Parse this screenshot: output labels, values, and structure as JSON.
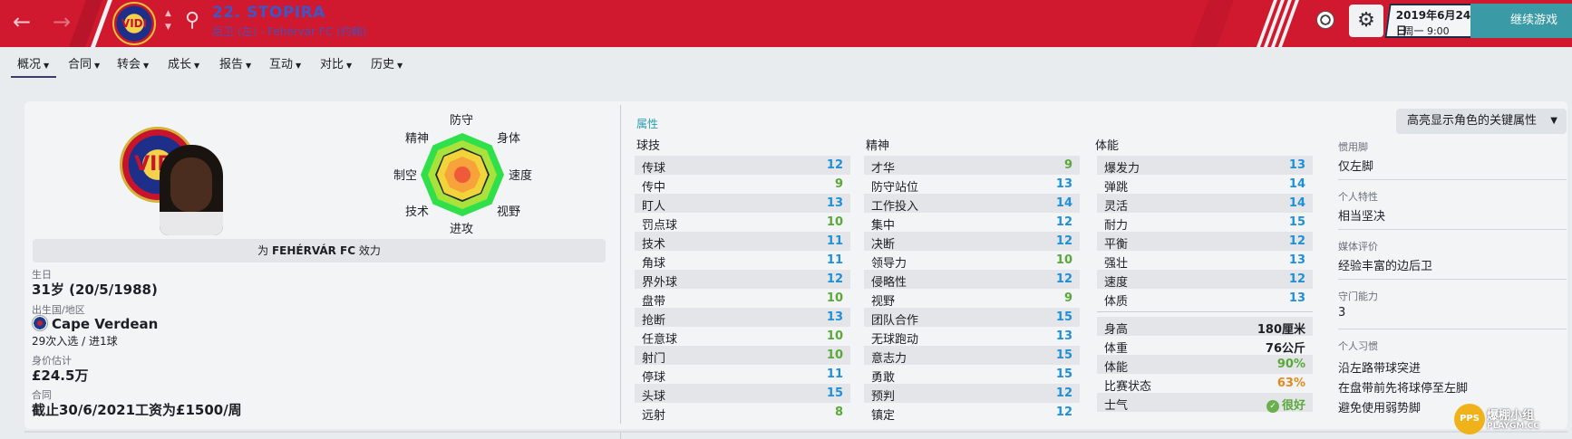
{
  "header": {
    "back_icon": "arrow-left-icon",
    "forward_icon": "arrow-right-icon",
    "club_badge_text": "VIDI",
    "player_title": "22. STOPIRA",
    "player_subtitle": "后卫 (左) - Fehérvár FC (约翰)",
    "continue_label": "继续游戏",
    "date_main": "2019年6月24日",
    "date_sub": "周一 9:00",
    "colors": {
      "primary": "#d0182e",
      "accent": "#3a9aa5"
    }
  },
  "tabs": [
    {
      "label": "概况"
    },
    {
      "label": "合同"
    },
    {
      "label": "转会"
    },
    {
      "label": "成长"
    },
    {
      "label": "报告"
    },
    {
      "label": "互动"
    },
    {
      "label": "对比"
    },
    {
      "label": "历史"
    }
  ],
  "radar": {
    "labels": {
      "defending": "防守",
      "physical": "身体",
      "speed": "速度",
      "vision": "视野",
      "attacking": "进攻",
      "technique": "技术",
      "aerial": "制空",
      "mental": "精神"
    }
  },
  "profile": {
    "club_badge_text": "VIDI",
    "plays_for_prefix": "为 ",
    "plays_for_club": "FEHÉRVÁR FC",
    "plays_for_suffix": " 效力",
    "dob_label": "生日",
    "dob_value": "31岁 (20/5/1988)",
    "nation_label": "出生国/地区",
    "nation_value": "Cape Verdean",
    "caps": "29次入选 / 进1球",
    "value_label": "身价估计",
    "value_value": "£24.5万",
    "contract_label": "合同",
    "contract_value": "截止30/6/2021工资为£1500/周"
  },
  "attributes": {
    "section_title": "属性",
    "highlight_button": "高亮显示角色的关键属性",
    "technical_title": "球技",
    "mental_title": "精神",
    "physical_title": "体能",
    "technical": [
      {
        "name": "传球",
        "value": "12"
      },
      {
        "name": "传中",
        "value": "9"
      },
      {
        "name": "盯人",
        "value": "13"
      },
      {
        "name": "罚点球",
        "value": "10"
      },
      {
        "name": "技术",
        "value": "11"
      },
      {
        "name": "角球",
        "value": "11"
      },
      {
        "name": "界外球",
        "value": "12"
      },
      {
        "name": "盘带",
        "value": "10"
      },
      {
        "name": "抢断",
        "value": "13"
      },
      {
        "name": "任意球",
        "value": "10"
      },
      {
        "name": "射门",
        "value": "10"
      },
      {
        "name": "停球",
        "value": "11"
      },
      {
        "name": "头球",
        "value": "15"
      },
      {
        "name": "远射",
        "value": "8"
      }
    ],
    "mental": [
      {
        "name": "才华",
        "value": "9"
      },
      {
        "name": "防守站位",
        "value": "13"
      },
      {
        "name": "工作投入",
        "value": "14"
      },
      {
        "name": "集中",
        "value": "12"
      },
      {
        "name": "决断",
        "value": "12"
      },
      {
        "name": "领导力",
        "value": "10"
      },
      {
        "name": "侵略性",
        "value": "12"
      },
      {
        "name": "视野",
        "value": "9"
      },
      {
        "name": "团队合作",
        "value": "15"
      },
      {
        "name": "无球跑动",
        "value": "13"
      },
      {
        "name": "意志力",
        "value": "15"
      },
      {
        "name": "勇敢",
        "value": "15"
      },
      {
        "name": "预判",
        "value": "12"
      },
      {
        "name": "镇定",
        "value": "12"
      }
    ],
    "physical": [
      {
        "name": "爆发力",
        "value": "13"
      },
      {
        "name": "弹跳",
        "value": "14"
      },
      {
        "name": "灵活",
        "value": "14"
      },
      {
        "name": "耐力",
        "value": "15"
      },
      {
        "name": "平衡",
        "value": "12"
      },
      {
        "name": "强壮",
        "value": "13"
      },
      {
        "name": "速度",
        "value": "12"
      },
      {
        "name": "体质",
        "value": "13"
      }
    ],
    "extras": [
      {
        "name": "身高",
        "value": "180厘米"
      },
      {
        "name": "体重",
        "value": "76公斤"
      },
      {
        "name": "体能",
        "value": "90%"
      },
      {
        "name": "比赛状态",
        "value": "63%"
      },
      {
        "name": "士气",
        "value": "很好"
      }
    ],
    "colors": {
      "low": "#5aa83a",
      "high": "#1f8fd6",
      "condition": "#5aa83a",
      "form": "#e08a1e"
    }
  },
  "side": {
    "foot_label": "惯用脚",
    "foot_value": "仅左脚",
    "personality_label": "个人特性",
    "personality_value": "相当坚决",
    "media_label": "媒体评价",
    "media_value": "经验丰富的边后卫",
    "gk_label": "守门能力",
    "gk_value": "3",
    "habits_label": "个人习惯",
    "habits": [
      "沿左路带球突进",
      "在盘带前先将球停至左脚",
      "避免使用弱势脚"
    ]
  },
  "watermark": {
    "badge": "PPS",
    "title": "爆棚小组",
    "sub": "PLAYGM.CC"
  }
}
